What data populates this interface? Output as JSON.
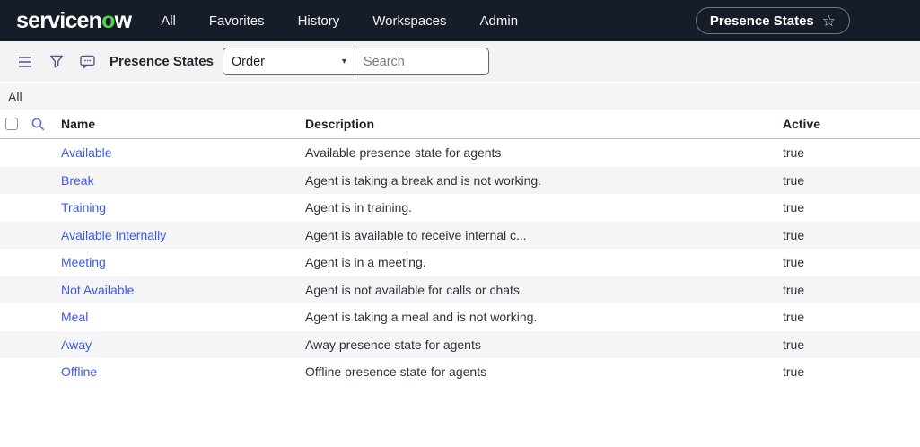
{
  "navbar": {
    "logo": {
      "prefix": "servicen",
      "o": "o",
      "suffix": "w"
    },
    "items": [
      {
        "label": "All"
      },
      {
        "label": "Favorites"
      },
      {
        "label": "History"
      },
      {
        "label": "Workspaces"
      },
      {
        "label": "Admin"
      }
    ],
    "pill": {
      "label": "Presence States"
    }
  },
  "toolbar": {
    "title": "Presence States",
    "order_select": {
      "value": "Order"
    },
    "search": {
      "placeholder": "Search"
    }
  },
  "breadcrumb": {
    "label": "All"
  },
  "table": {
    "columns": [
      "Name",
      "Description",
      "Active"
    ],
    "rows": [
      {
        "name": "Available",
        "description": "Available presence state for agents",
        "active": "true"
      },
      {
        "name": "Break",
        "description": "Agent is taking a break and is not working.",
        "active": "true"
      },
      {
        "name": "Training",
        "description": "Agent is in training.",
        "active": "true"
      },
      {
        "name": "Available Internally",
        "description": "Agent is available to receive internal c...",
        "active": "true"
      },
      {
        "name": "Meeting",
        "description": "Agent is in a meeting.",
        "active": "true"
      },
      {
        "name": "Not Available",
        "description": "Agent is not available for calls or chats.",
        "active": "true"
      },
      {
        "name": "Meal",
        "description": "Agent is taking a meal and is not working.",
        "active": "true"
      },
      {
        "name": "Away",
        "description": "Away presence state for agents",
        "active": "true"
      },
      {
        "name": "Offline",
        "description": "Offline presence state for agents",
        "active": "true"
      }
    ]
  },
  "icons": {
    "favorite_star": "☆",
    "order_caret": "▾",
    "list_menu": "hamburger-lines",
    "filter": "funnel",
    "comments": "speech-bubble-dots",
    "column_search": "magnifier"
  },
  "colors": {
    "navbar_bg": "#171c29",
    "logo_green": "#4ed44a",
    "link_blue": "#3c59e7",
    "toolbar_icon": "#53568f",
    "toolbar_bg": "#f3f3f4",
    "zebra_row": "#f5f5f7"
  }
}
